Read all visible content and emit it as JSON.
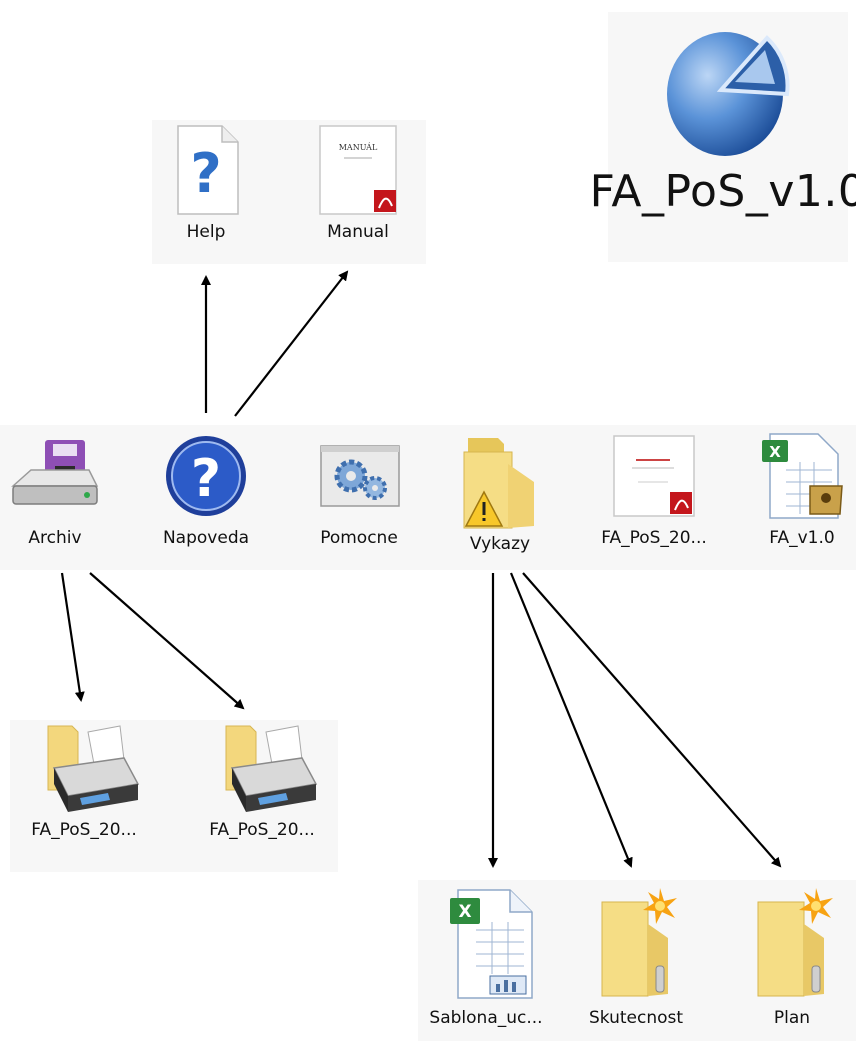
{
  "app": {
    "title": "FA_PoS_v1.0",
    "icon": "pie-chart-icon"
  },
  "help_items": [
    {
      "label": "Help",
      "icon": "help-document-icon"
    },
    {
      "label": "Manual",
      "icon": "pdf-document-icon",
      "doc_heading": "MANUÁL"
    }
  ],
  "main_items": [
    {
      "label": "Archiv",
      "icon": "floppy-drive-icon"
    },
    {
      "label": "Napoveda",
      "icon": "help-circle-icon"
    },
    {
      "label": "Pomocne",
      "icon": "gears-window-icon"
    },
    {
      "label": "Vykazy",
      "icon": "warning-folder-icon"
    },
    {
      "label": "FA_PoS_20...",
      "icon": "pdf-document-icon"
    },
    {
      "label": "FA_v1.0",
      "icon": "excel-document-icon"
    }
  ],
  "archive_items": [
    {
      "label": "FA_PoS_20...",
      "icon": "printer-folder-icon"
    },
    {
      "label": "FA_PoS_20...",
      "icon": "printer-folder-icon"
    }
  ],
  "report_items": [
    {
      "label": "Sablona_uc...",
      "icon": "excel-chart-document-icon"
    },
    {
      "label": "Skutecnost",
      "icon": "new-folder-icon"
    },
    {
      "label": "Plan",
      "icon": "new-folder-icon"
    }
  ],
  "colors": {
    "arrow": "#000000",
    "folder": "#f2d77a",
    "panel": "#f7f7f7",
    "globe": "#3f7fd0"
  }
}
